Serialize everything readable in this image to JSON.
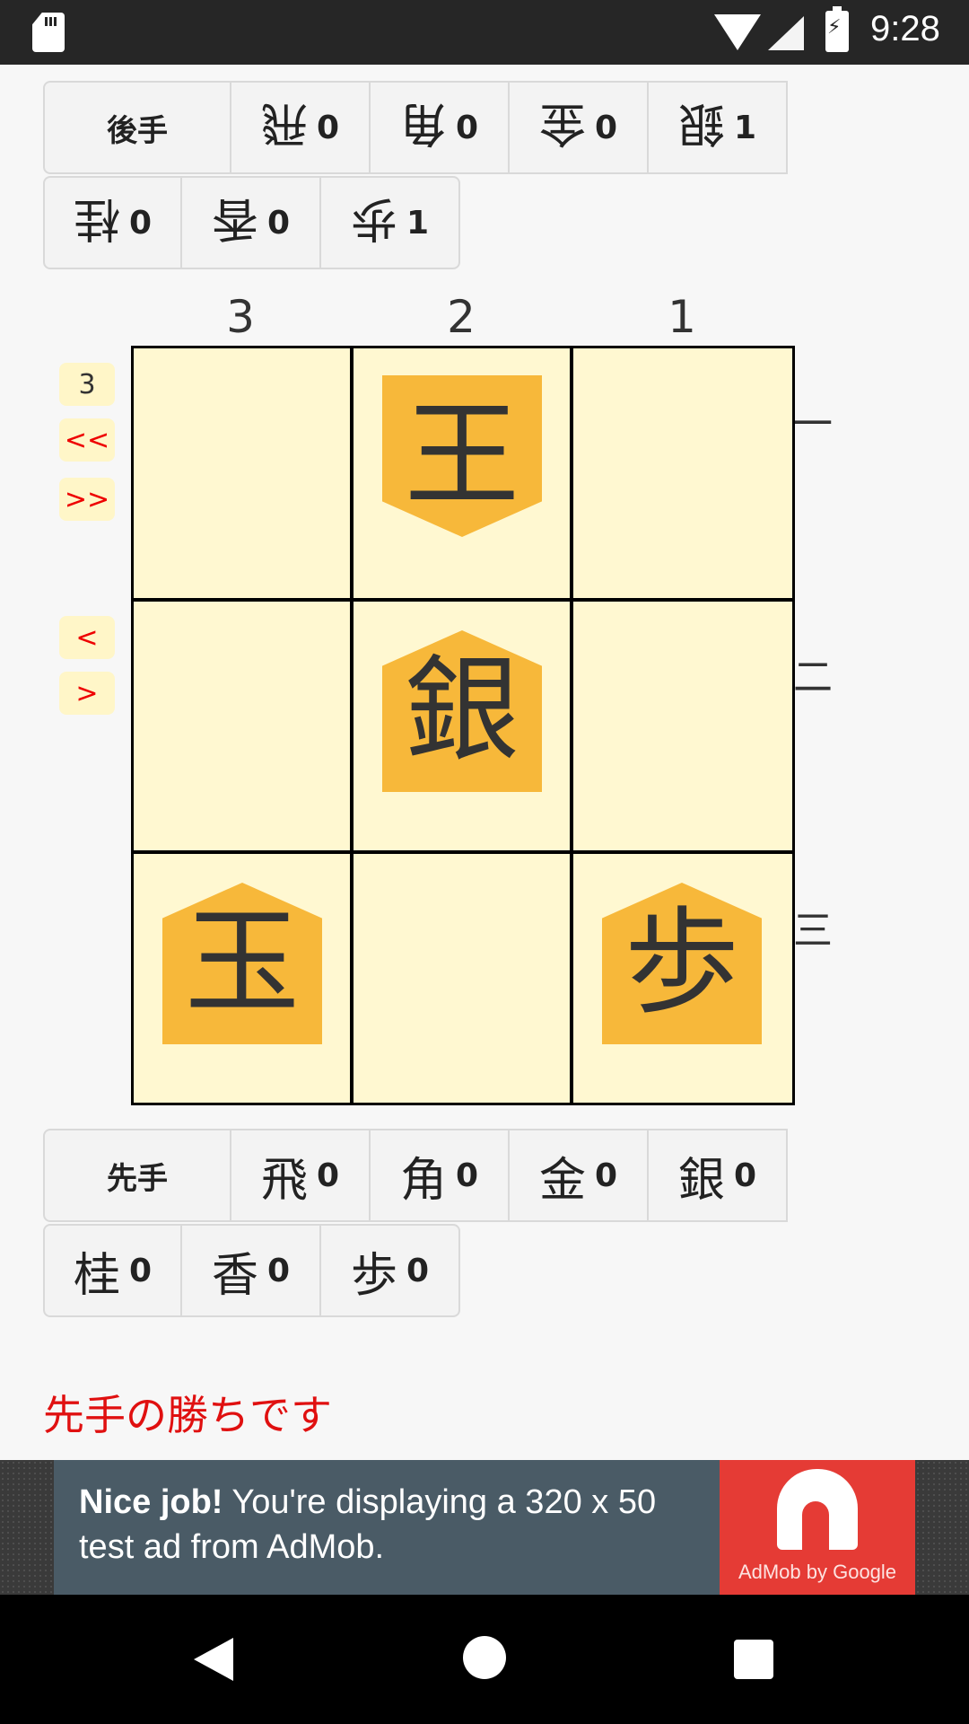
{
  "status_bar": {
    "time": "9:28"
  },
  "gote_hand": {
    "label": "後手",
    "pieces": [
      {
        "char": "飛",
        "count": "0"
      },
      {
        "char": "角",
        "count": "0"
      },
      {
        "char": "金",
        "count": "0"
      },
      {
        "char": "銀",
        "count": "1"
      },
      {
        "char": "桂",
        "count": "0"
      },
      {
        "char": "香",
        "count": "0"
      },
      {
        "char": "歩",
        "count": "1"
      }
    ]
  },
  "board": {
    "columns": [
      "3",
      "2",
      "1"
    ],
    "rows": [
      "一",
      "二",
      "三"
    ],
    "pieces": {
      "r0c1": "王",
      "r1c1": "銀",
      "r2c0": "玉",
      "r2c2": "歩"
    }
  },
  "controls": {
    "move_number": "3",
    "first": "<<",
    "last": ">>",
    "prev": "<",
    "next": ">"
  },
  "sente_hand": {
    "label": "先手",
    "pieces": [
      {
        "char": "飛",
        "count": "0"
      },
      {
        "char": "角",
        "count": "0"
      },
      {
        "char": "金",
        "count": "0"
      },
      {
        "char": "銀",
        "count": "0"
      },
      {
        "char": "桂",
        "count": "0"
      },
      {
        "char": "香",
        "count": "0"
      },
      {
        "char": "歩",
        "count": "0"
      }
    ]
  },
  "result_text": "先手の勝ちです",
  "ad": {
    "headline": "Nice job!",
    "body": " You're displaying a 320 x 50 test ad from AdMob.",
    "brand": "AdMob by Google"
  }
}
